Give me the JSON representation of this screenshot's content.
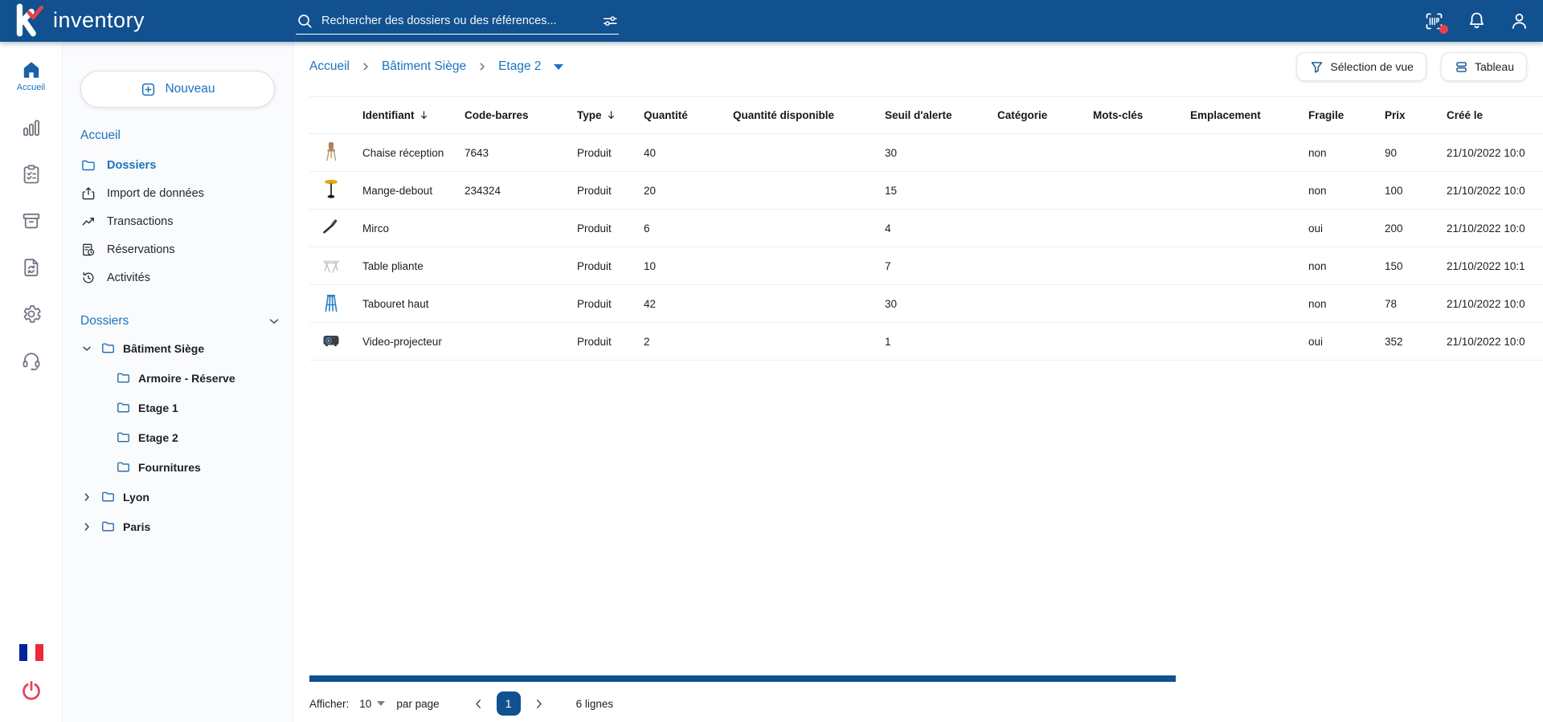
{
  "colors": {
    "header_blue": "#11518F",
    "accent_blue": "#1A73C0",
    "danger_red": "#E8404F",
    "scrollbar_blue": "#11518F"
  },
  "header": {
    "brand": "inventory",
    "search_placeholder": "Rechercher des dossiers ou des références...",
    "icons": [
      "barcode-scanner-icon",
      "bell-icon",
      "account-icon"
    ]
  },
  "rail": {
    "home_label": "Accueil",
    "icons": [
      "home-icon",
      "bar-chart-icon",
      "checklist-icon",
      "archive-box-icon",
      "document-sync-icon",
      "gear-icon",
      "headset-icon",
      "france-flag",
      "power-icon"
    ]
  },
  "sidebar": {
    "new_button": "Nouveau",
    "home_link": "Accueil",
    "items": [
      {
        "label": "Dossiers",
        "icon": "folder-icon",
        "active": true
      },
      {
        "label": "Import de données",
        "icon": "upload-icon"
      },
      {
        "label": "Transactions",
        "icon": "trend-icon"
      },
      {
        "label": "Réservations",
        "icon": "document-clock-icon"
      },
      {
        "label": "Activités",
        "icon": "history-icon"
      }
    ],
    "section_title": "Dossiers",
    "tree": {
      "root": "Bâtiment Siège",
      "root_children": [
        "Armoire - Réserve",
        "Etage 1",
        "Etage 2",
        "Fournitures"
      ],
      "collapsed": [
        "Lyon",
        "Paris"
      ]
    }
  },
  "toolbar": {
    "breadcrumb": [
      "Accueil",
      "Bâtiment Siège",
      "Etage 2"
    ],
    "view_selection_button": "Sélection de vue",
    "table_button": "Tableau"
  },
  "table": {
    "columns": [
      "Identifiant",
      "Code-barres",
      "Type",
      "Quantité",
      "Quantité disponible",
      "Seuil d'alerte",
      "Catégorie",
      "Mots-clés",
      "Emplacement",
      "Fragile",
      "Prix",
      "Créé le"
    ],
    "sorted_columns": [
      "Identifiant",
      "Type"
    ],
    "rows": [
      {
        "thumb": "chair",
        "identifiant": "Chaise réception",
        "code_barres": "7643",
        "type": "Produit",
        "quantite": "40",
        "quantite_disponible": "",
        "seuil_alerte": "30",
        "categorie": "",
        "mots_cles": "",
        "emplacement": "",
        "fragile": "non",
        "prix": "90",
        "cree_le": "21/10/2022 10:0"
      },
      {
        "thumb": "standing-table",
        "identifiant": "Mange-debout",
        "code_barres": "234324",
        "type": "Produit",
        "quantite": "20",
        "quantite_disponible": "",
        "seuil_alerte": "15",
        "categorie": "",
        "mots_cles": "",
        "emplacement": "",
        "fragile": "non",
        "prix": "100",
        "cree_le": "21/10/2022 10:0"
      },
      {
        "thumb": "microphone",
        "identifiant": "Mirco",
        "code_barres": "",
        "type": "Produit",
        "quantite": "6",
        "quantite_disponible": "",
        "seuil_alerte": "4",
        "categorie": "",
        "mots_cles": "",
        "emplacement": "",
        "fragile": "oui",
        "prix": "200",
        "cree_le": "21/10/2022 10:0"
      },
      {
        "thumb": "folding-table",
        "identifiant": "Table pliante",
        "code_barres": "",
        "type": "Produit",
        "quantite": "10",
        "quantite_disponible": "",
        "seuil_alerte": "7",
        "categorie": "",
        "mots_cles": "",
        "emplacement": "",
        "fragile": "non",
        "prix": "150",
        "cree_le": "21/10/2022 10:1"
      },
      {
        "thumb": "stool",
        "identifiant": "Tabouret haut",
        "code_barres": "",
        "type": "Produit",
        "quantite": "42",
        "quantite_disponible": "",
        "seuil_alerte": "30",
        "categorie": "",
        "mots_cles": "",
        "emplacement": "",
        "fragile": "non",
        "prix": "78",
        "cree_le": "21/10/2022 10:0"
      },
      {
        "thumb": "projector",
        "identifiant": "Video-projecteur",
        "code_barres": "",
        "type": "Produit",
        "quantite": "2",
        "quantite_disponible": "",
        "seuil_alerte": "1",
        "categorie": "",
        "mots_cles": "",
        "emplacement": "",
        "fragile": "oui",
        "prix": "352",
        "cree_le": "21/10/2022 10:0"
      }
    ]
  },
  "pagination": {
    "show_label": "Afficher:",
    "page_size": "10",
    "per_page_label": "par page",
    "current_page": "1",
    "total_label": "6 lignes"
  }
}
